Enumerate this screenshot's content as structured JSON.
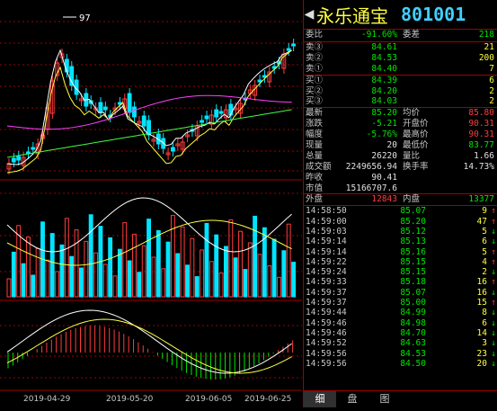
{
  "chart": {
    "peak_label": "97",
    "dates": [
      "2019-04-29",
      "2019-05-20",
      "2019-06-05",
      "2019-06-25"
    ],
    "colors": {
      "up": "#ff3c3c",
      "down": "#00e5ff",
      "ma5": "#ffffff",
      "ma10": "#ffff40",
      "ma20": "#ff40ff",
      "ma60": "#40ff40",
      "grid": "#a00000"
    }
  },
  "header": {
    "name": "永乐通宝",
    "code": "801001"
  },
  "committee": [
    {
      "label": "委比",
      "value": "-91.60%",
      "label2": "委差",
      "value2": "218"
    }
  ],
  "asks": [
    {
      "label": "卖③",
      "price": "84.61",
      "vol": "21"
    },
    {
      "label": "卖②",
      "price": "84.53",
      "vol": "200"
    },
    {
      "label": "卖①",
      "price": "84.40",
      "vol": "7"
    }
  ],
  "bids": [
    {
      "label": "买①",
      "price": "84.39",
      "vol": "6"
    },
    {
      "label": "买②",
      "price": "84.20",
      "vol": "2"
    },
    {
      "label": "买③",
      "price": "84.03",
      "vol": "2"
    }
  ],
  "stats": [
    {
      "l1": "最新",
      "v1": "85.20",
      "l2": "均价",
      "v2": "85.80"
    },
    {
      "l1": "涨跌",
      "v1": "-5.21",
      "l2": "开盘价",
      "v2": "90.31"
    },
    {
      "l1": "幅度",
      "v1": "-5.76%",
      "l2": "最高价",
      "v2": "90.31"
    },
    {
      "l1": "现量",
      "v1": "20",
      "l2": "最低价",
      "v2": "83.77"
    },
    {
      "l1": "总量",
      "v1": "26220",
      "l2": "量比",
      "v2": "1.66"
    },
    {
      "l1": "成交额",
      "v1": "2249656.94",
      "l2": "换手率",
      "v2": "14.73%"
    },
    {
      "l1": "昨收",
      "v1": "90.41",
      "l2": "",
      "v2": ""
    },
    {
      "l1": "市值",
      "v1": "15166707.6",
      "l2": "",
      "v2": ""
    }
  ],
  "outer_inner": {
    "l1": "外盘",
    "v1": "12843",
    "l2": "内盘",
    "v2": "13377"
  },
  "ticks": [
    {
      "time": "14:58:50",
      "price": "85.07",
      "vol": "9",
      "dir": "↑"
    },
    {
      "time": "14:59:00",
      "price": "85.20",
      "vol": "47",
      "dir": "↑"
    },
    {
      "time": "14:59:03",
      "price": "85.12",
      "vol": "5",
      "dir": "↓"
    },
    {
      "time": "14:59:14",
      "price": "85.13",
      "vol": "6",
      "dir": "↓"
    },
    {
      "time": "14:59:14",
      "price": "85.16",
      "vol": "5",
      "dir": "↑"
    },
    {
      "time": "14:59:22",
      "price": "85.15",
      "vol": "4",
      "dir": "↑"
    },
    {
      "time": "14:59:24",
      "price": "85.15",
      "vol": "2",
      "dir": "↓"
    },
    {
      "time": "14:59:33",
      "price": "85.18",
      "vol": "16",
      "dir": "↑"
    },
    {
      "time": "14:59:37",
      "price": "85.07",
      "vol": "16",
      "dir": "↓"
    },
    {
      "time": "14:59:37",
      "price": "85.00",
      "vol": "15",
      "dir": "↑"
    },
    {
      "time": "14:59:44",
      "price": "84.99",
      "vol": "8",
      "dir": "↓"
    },
    {
      "time": "14:59:46",
      "price": "84.98",
      "vol": "6",
      "dir": "↓"
    },
    {
      "time": "14:59:46",
      "price": "84.70",
      "vol": "14",
      "dir": "↓"
    },
    {
      "time": "14:59:52",
      "price": "84.63",
      "vol": "3",
      "dir": "↓"
    },
    {
      "time": "14:59:56",
      "price": "84.53",
      "vol": "23",
      "dir": "↓"
    },
    {
      "time": "14:59:56",
      "price": "84.50",
      "vol": "20",
      "dir": "↓"
    }
  ],
  "tabs": [
    "细",
    "盘",
    "图"
  ]
}
